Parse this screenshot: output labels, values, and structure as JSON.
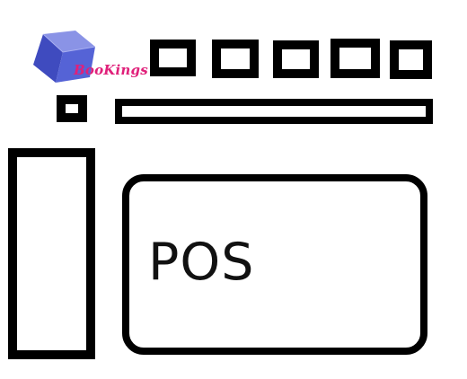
{
  "logo": {
    "text": "BooKings",
    "text_color": "#e0207a",
    "cube_color": "#4a57c7",
    "icon": "cube-icon"
  },
  "toolbar": {
    "buttons": [
      {
        "name": "toolbar-button-1"
      },
      {
        "name": "toolbar-button-2"
      },
      {
        "name": "toolbar-button-3"
      },
      {
        "name": "toolbar-button-4"
      },
      {
        "name": "toolbar-button-5"
      }
    ]
  },
  "main": {
    "pos_label": "POS"
  },
  "colors": {
    "outline": "#000000",
    "background": "#ffffff"
  }
}
